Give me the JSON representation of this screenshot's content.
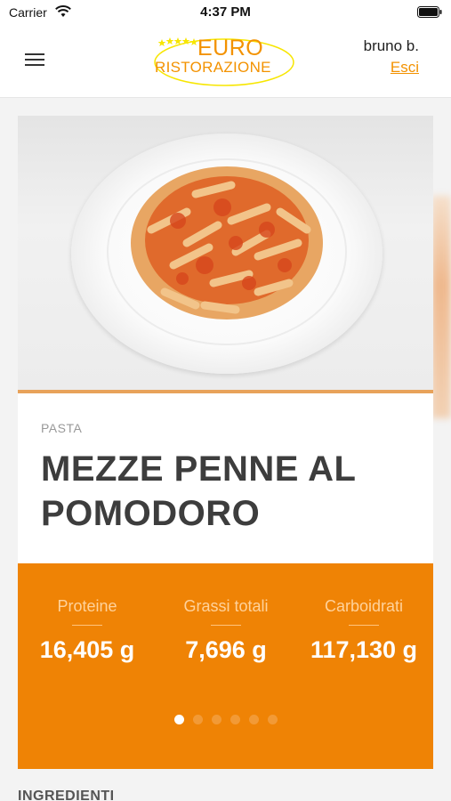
{
  "status_bar": {
    "carrier": "Carrier",
    "time": "4:37 PM"
  },
  "header": {
    "logo_top": "EURO",
    "logo_bottom": "RISTORAZIONE",
    "user_name": "bruno b.",
    "logout_label": "Esci"
  },
  "dish": {
    "category": "PASTA",
    "title": "MEZZE PENNE AL POMODORO"
  },
  "nutrition": {
    "items": [
      {
        "label": "Proteine",
        "value": "16,405 g"
      },
      {
        "label": "Grassi totali",
        "value": "7,696 g"
      },
      {
        "label": "Carboidrati",
        "value": "117,130 g"
      }
    ],
    "pager": {
      "pages": 6,
      "active_page": 1
    }
  },
  "ingredients": {
    "heading": "INGREDIENTI"
  },
  "colors": {
    "accent": "#f39200",
    "nutrition_background": "#ef8305",
    "title_text": "#3d3d3d"
  },
  "icons": {
    "menu": "hamburger-menu-icon",
    "wifi": "wifi-icon",
    "battery": "battery-icon"
  }
}
